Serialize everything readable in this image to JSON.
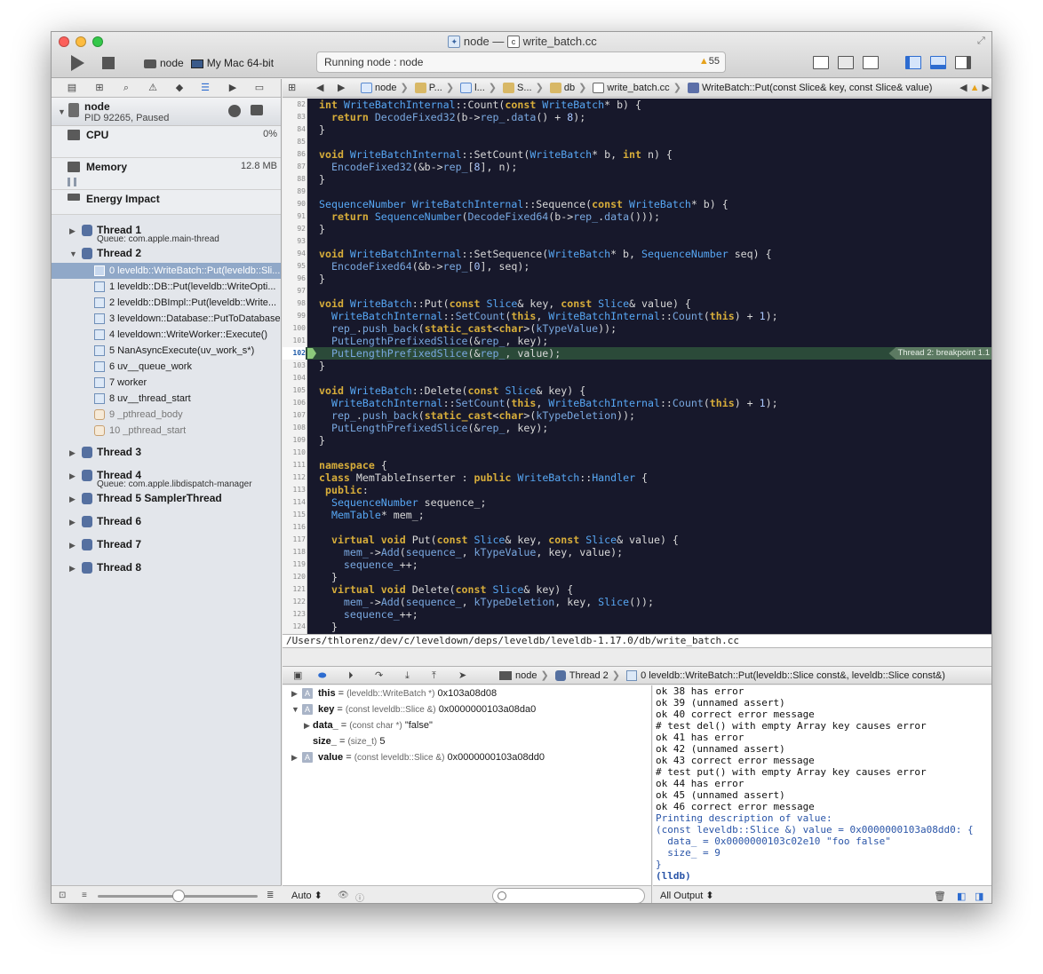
{
  "window": {
    "title_project": "node",
    "title_sep": "—",
    "title_file": "write_batch.cc"
  },
  "toolbar": {
    "scheme": "node",
    "destination": "My Mac 64-bit",
    "status": "Running node : node",
    "warnings": "55"
  },
  "process": {
    "name": "node",
    "pid": "PID 92265, Paused"
  },
  "gauges": [
    {
      "label": "CPU",
      "value": "0%"
    },
    {
      "label": "Memory",
      "value": "12.8 MB"
    },
    {
      "label": "Energy Impact",
      "value": ""
    }
  ],
  "threads": {
    "t1": {
      "name": "Thread 1",
      "queue": "Queue: com.apple.main-thread"
    },
    "t2": {
      "name": "Thread 2"
    },
    "t3": {
      "name": "Thread 3"
    },
    "t4": {
      "name": "Thread 4",
      "queue": "Queue: com.apple.libdispatch-manager"
    },
    "t5": {
      "name": "Thread 5 SamplerThread"
    },
    "t6": {
      "name": "Thread 6"
    },
    "t7": {
      "name": "Thread 7"
    },
    "t8": {
      "name": "Thread 8"
    }
  },
  "frames": [
    "0 leveldb::WriteBatch::Put(leveldb::Sli...",
    "1 leveldb::DB::Put(leveldb::WriteOpti...",
    "2 leveldb::DBImpl::Put(leveldb::Write...",
    "3 leveldown::Database::PutToDatabase...",
    "4 leveldown::WriteWorker::Execute()",
    "5 NanAsyncExecute(uv_work_s*)",
    "6 uv__queue_work",
    "7 worker",
    "8 uv__thread_start",
    "9 _pthread_body",
    "10 _pthread_start"
  ],
  "jumpbar": {
    "p1": "node",
    "p2": "P...",
    "p3": "l...",
    "p4": "S...",
    "p5": "db",
    "p6": "write_batch.cc",
    "p7": "WriteBatch::Put(const Slice& key, const Slice& value)"
  },
  "breakpoint_badge": "Thread 2: breakpoint 1.1",
  "file_path": "/Users/thlorenz/dev/c/leveldown/deps/leveldb/leveldb-1.17.0/db/write_batch.cc",
  "debug_bar": {
    "process": "node",
    "thread": "Thread 2",
    "frame": "0 leveldb::WriteBatch::Put(leveldb::Slice const&, leveldb::Slice const&)"
  },
  "variables": [
    {
      "name": "this",
      "type": "(leveldb::WriteBatch *)",
      "value": "0x103a08d08"
    },
    {
      "name": "key",
      "type": "(const leveldb::Slice &)",
      "value": "0x0000000103a08da0"
    },
    {
      "name": "data_",
      "type": "(const char *)",
      "value": "\"false\""
    },
    {
      "name": "size_",
      "type": "(size_t)",
      "value": "5"
    },
    {
      "name": "value",
      "type": "(const leveldb::Slice &)",
      "value": "0x0000000103a08dd0"
    }
  ],
  "console": [
    "ok 38 has error",
    "ok 39 (unnamed assert)",
    "ok 40 correct error message",
    "# test del() with empty Array key causes error",
    "ok 41 has error",
    "ok 42 (unnamed assert)",
    "ok 43 correct error message",
    "# test put() with empty Array key causes error",
    "ok 44 has error",
    "ok 45 (unnamed assert)",
    "ok 46 correct error message",
    "Printing description of value:",
    "(const leveldb::Slice &) value = 0x0000000103a08dd0: {",
    "  data_ = 0x0000000103c02e10 \"foo false\"",
    "  size_ = 9",
    "}",
    "(lldb)"
  ],
  "var_bottom": {
    "scope": "Auto ⬍"
  },
  "console_bottom": {
    "output": "All Output ⬍"
  },
  "code": {
    "l82": "82",
    "l83": "83",
    "l84": "84",
    "l85": "85",
    "l86": "86",
    "l87": "87",
    "l88": "88",
    "l89": "89",
    "l90": "90",
    "l91": "91",
    "l92": "92",
    "l93": "93",
    "l94": "94",
    "l95": "95",
    "l96": "96",
    "l97": "97",
    "l98": "98",
    "l99": "99",
    "l100": "100",
    "l101": "101",
    "l102": "102",
    "l103": "103",
    "l104": "104",
    "l105": "105",
    "l106": "106",
    "l107": "107",
    "l108": "108",
    "l109": "109",
    "l110": "110",
    "l111": "111",
    "l112": "112",
    "l113": "113",
    "l114": "114",
    "l115": "115",
    "l116": "116",
    "l117": "117",
    "l118": "118",
    "l119": "119",
    "l120": "120",
    "l121": "121",
    "l122": "122",
    "l123": "123",
    "l124": "124",
    "s_82_a": "int ",
    "s_82_b": "WriteBatchInternal",
    "s_82_c": "::Count(",
    "s_82_d": "const ",
    "s_82_e": "WriteBatch",
    "s_82_f": "* b) {",
    "s_83_a": "  return ",
    "s_83_b": "DecodeFixed32",
    "s_83_c": "(b->",
    "s_83_d": "rep_",
    "s_83_e": ".",
    "s_83_f": "data",
    "s_83_g": "() + ",
    "s_83_h": "8",
    "s_83_i": ");",
    "s_84": "}",
    "s_86_a": "void ",
    "s_86_b": "WriteBatchInternal",
    "s_86_c": "::SetCount(",
    "s_86_d": "WriteBatch",
    "s_86_e": "* b, ",
    "s_86_f": "int ",
    "s_86_g": "n) {",
    "s_87_a": "  ",
    "s_87_b": "EncodeFixed32",
    "s_87_c": "(&b->",
    "s_87_d": "rep_",
    "s_87_e": "[",
    "s_87_f": "8",
    "s_87_g": "], n);",
    "s_88": "}",
    "s_90_a": "SequenceNumber ",
    "s_90_b": "WriteBatchInternal",
    "s_90_c": "::Sequence(",
    "s_90_d": "const ",
    "s_90_e": "WriteBatch",
    "s_90_f": "* b) {",
    "s_91_a": "  return ",
    "s_91_b": "SequenceNumber",
    "s_91_c": "(",
    "s_91_d": "DecodeFixed64",
    "s_91_e": "(b->",
    "s_91_f": "rep_",
    "s_91_g": ".",
    "s_91_h": "data",
    "s_91_i": "()));",
    "s_92": "}",
    "s_94_a": "void ",
    "s_94_b": "WriteBatchInternal",
    "s_94_c": "::SetSequence(",
    "s_94_d": "WriteBatch",
    "s_94_e": "* b, ",
    "s_94_f": "SequenceNumber ",
    "s_94_g": "seq) {",
    "s_95_a": "  ",
    "s_95_b": "EncodeFixed64",
    "s_95_c": "(&b->",
    "s_95_d": "rep_",
    "s_95_e": "[",
    "s_95_f": "0",
    "s_95_g": "], seq);",
    "s_96": "}",
    "s_98_a": "void ",
    "s_98_b": "WriteBatch",
    "s_98_c": "::Put(",
    "s_98_d": "const ",
    "s_98_e": "Slice",
    "s_98_f": "& key, ",
    "s_98_g": "const ",
    "s_98_h": "Slice",
    "s_98_i": "& value) {",
    "s_99_a": "  ",
    "s_99_b": "WriteBatchInternal",
    "s_99_c": "::",
    "s_99_d": "SetCount",
    "s_99_e": "(",
    "s_99_f": "this",
    "s_99_g": ", ",
    "s_99_h": "WriteBatchInternal",
    "s_99_i": "::",
    "s_99_j": "Count",
    "s_99_k": "(",
    "s_99_l": "this",
    "s_99_m": ") + ",
    "s_99_n": "1",
    "s_99_o": ");",
    "s_100_a": "  ",
    "s_100_b": "rep_",
    "s_100_c": ".",
    "s_100_d": "push_back",
    "s_100_e": "(",
    "s_100_f": "static_cast",
    "s_100_g": "<",
    "s_100_h": "char",
    "s_100_i": ">(",
    "s_100_j": "kTypeValue",
    "s_100_k": "));",
    "s_101_a": "  ",
    "s_101_b": "PutLengthPrefixedSlice",
    "s_101_c": "(&",
    "s_101_d": "rep_",
    "s_101_e": ", key);",
    "s_102_a": "  ",
    "s_102_b": "PutLengthPrefixedSlice",
    "s_102_c": "(&",
    "s_102_d": "rep_",
    "s_102_e": ", value);",
    "s_103": "}",
    "s_105_a": "void ",
    "s_105_b": "WriteBatch",
    "s_105_c": "::Delete(",
    "s_105_d": "const ",
    "s_105_e": "Slice",
    "s_105_f": "& key) {",
    "s_106_a": "  ",
    "s_106_b": "WriteBatchInternal",
    "s_106_c": "::",
    "s_106_d": "SetCount",
    "s_106_e": "(",
    "s_106_f": "this",
    "s_106_g": ", ",
    "s_106_h": "WriteBatchInternal",
    "s_106_i": "::",
    "s_106_j": "Count",
    "s_106_k": "(",
    "s_106_l": "this",
    "s_106_m": ") + ",
    "s_106_n": "1",
    "s_106_o": ");",
    "s_107_a": "  ",
    "s_107_b": "rep_",
    "s_107_c": ".",
    "s_107_d": "push_back",
    "s_107_e": "(",
    "s_107_f": "static_cast",
    "s_107_g": "<",
    "s_107_h": "char",
    "s_107_i": ">(",
    "s_107_j": "kTypeDeletion",
    "s_107_k": "));",
    "s_108_a": "  ",
    "s_108_b": "PutLengthPrefixedSlice",
    "s_108_c": "(&",
    "s_108_d": "rep_",
    "s_108_e": ", key);",
    "s_109": "}",
    "s_111_a": "namespace ",
    "s_111_b": "{",
    "s_112_a": "class ",
    "s_112_b": "MemTableInserter ",
    "s_112_c": ": ",
    "s_112_d": "public ",
    "s_112_e": "WriteBatch",
    "s_112_f": "::",
    "s_112_g": "Handler",
    "s_112_h": " {",
    "s_113_a": " public",
    "s_113_b": ":",
    "s_114_a": "  ",
    "s_114_b": "SequenceNumber",
    "s_114_c": " sequence_;",
    "s_115_a": "  ",
    "s_115_b": "MemTable",
    "s_115_c": "* mem_;",
    "s_117_a": "  virtual void ",
    "s_117_b": "Put(",
    "s_117_c": "const ",
    "s_117_d": "Slice",
    "s_117_e": "& key, ",
    "s_117_f": "const ",
    "s_117_g": "Slice",
    "s_117_h": "& value) {",
    "s_118_a": "    ",
    "s_118_b": "mem_",
    "s_118_c": "->",
    "s_118_d": "Add",
    "s_118_e": "(",
    "s_118_f": "sequence_",
    "s_118_g": ", ",
    "s_118_h": "kTypeValue",
    "s_118_i": ", key, value);",
    "s_119_a": "    ",
    "s_119_b": "sequence_",
    "s_119_c": "++;",
    "s_120": "  }",
    "s_121_a": "  virtual void ",
    "s_121_b": "Delete(",
    "s_121_c": "const ",
    "s_121_d": "Slice",
    "s_121_e": "& key) {",
    "s_122_a": "    ",
    "s_122_b": "mem_",
    "s_122_c": "->",
    "s_122_d": "Add",
    "s_122_e": "(",
    "s_122_f": "sequence_",
    "s_122_g": ", ",
    "s_122_h": "kTypeDeletion",
    "s_122_i": ", key, ",
    "s_122_j": "Slice",
    "s_122_k": "());",
    "s_123_a": "    ",
    "s_123_b": "sequence_",
    "s_123_c": "++;",
    "s_124": "  }"
  }
}
